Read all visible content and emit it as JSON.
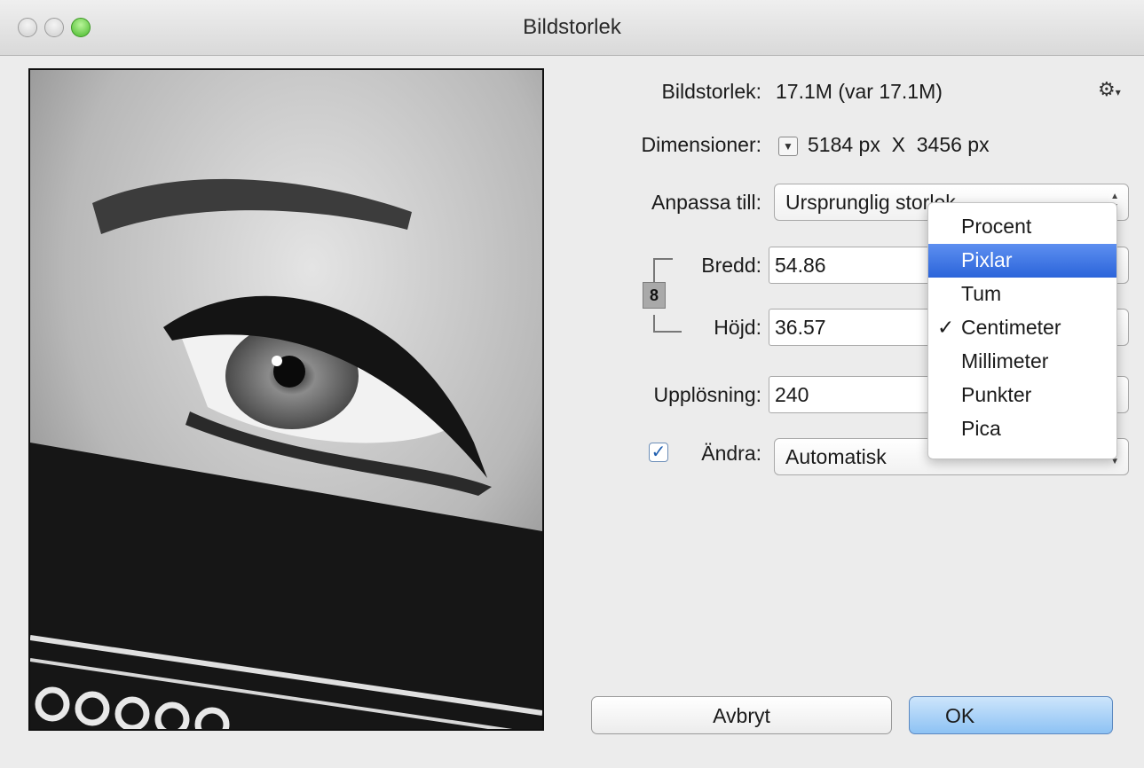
{
  "window": {
    "title": "Bildstorlek"
  },
  "info": {
    "size_label": "Bildstorlek:",
    "size_value": "17.1M (var 17.1M)",
    "dim_label": "Dimensioner:",
    "dim_value": "5184 px  X  3456 px"
  },
  "fit": {
    "label": "Anpassa till:",
    "value": "Ursprunglig storlek"
  },
  "width": {
    "label": "Bredd:",
    "value": "54.86"
  },
  "height": {
    "label": "Höjd:",
    "value": "36.57"
  },
  "resolution": {
    "label": "Upplösning:",
    "value": "240"
  },
  "resample": {
    "label": "Ändra:",
    "value": "Automatisk",
    "checked": true
  },
  "unit_menu": {
    "items": [
      "Procent",
      "Pixlar",
      "Tum",
      "Centimeter",
      "Millimeter",
      "Punkter",
      "Pica"
    ],
    "highlighted": "Pixlar",
    "checked": "Centimeter"
  },
  "buttons": {
    "cancel": "Avbryt",
    "ok": "OK"
  },
  "icons": {
    "gear": "gear-icon",
    "chain": "chain-link-icon",
    "dimension_toggle": "triangle-down-icon"
  },
  "colors": {
    "accent": "#2b64da",
    "ok_button": "#8dc2f4",
    "zoom_button": "#47b82a"
  }
}
